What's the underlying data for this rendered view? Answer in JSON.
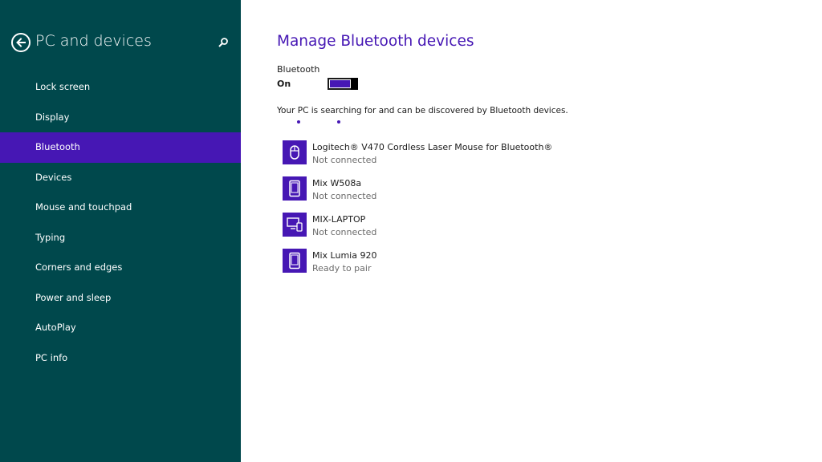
{
  "sidebar": {
    "title": "PC and devices",
    "back_icon": "back-arrow-icon",
    "search_icon": "search-icon",
    "items": [
      {
        "label": "Lock screen"
      },
      {
        "label": "Display"
      },
      {
        "label": "Bluetooth",
        "selected": true
      },
      {
        "label": "Devices"
      },
      {
        "label": "Mouse and touchpad"
      },
      {
        "label": "Typing"
      },
      {
        "label": "Corners and edges"
      },
      {
        "label": "Power and sleep"
      },
      {
        "label": "AutoPlay"
      },
      {
        "label": "PC info"
      }
    ]
  },
  "main": {
    "title": "Manage Bluetooth devices",
    "bluetooth_label": "Bluetooth",
    "bluetooth_state": "On",
    "status_text": "Your PC is searching for and can be discovered by Bluetooth devices.",
    "devices": [
      {
        "name": "Logitech® V470 Cordless Laser Mouse for Bluetooth®",
        "status": "Not connected",
        "icon": "mouse-icon"
      },
      {
        "name": "Mix W508a",
        "status": "Not connected",
        "icon": "phone-icon"
      },
      {
        "name": "MIX-LAPTOP",
        "status": "Not connected",
        "icon": "computer-icon"
      },
      {
        "name": "Mix Lumia 920",
        "status": "Ready to pair",
        "icon": "phone-icon"
      }
    ]
  },
  "colors": {
    "sidebar_bg": "#00484c",
    "accent": "#4617b4",
    "text": "#1a1a1a",
    "secondary_text": "#6b6b6b"
  }
}
